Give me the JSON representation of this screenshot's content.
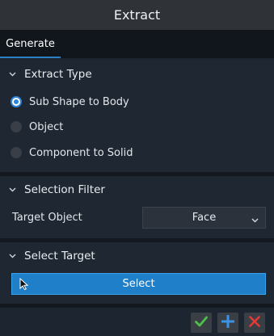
{
  "title": "Extract",
  "tabs": [
    {
      "label": "Generate",
      "active": true
    }
  ],
  "extract_type": {
    "header": "Extract Type",
    "options": [
      {
        "label": "Sub Shape to Body",
        "selected": true
      },
      {
        "label": "Object",
        "selected": false
      },
      {
        "label": "Component to Solid",
        "selected": false
      }
    ]
  },
  "selection_filter": {
    "header": "Selection Filter",
    "target_object_label": "Target Object",
    "target_object_value": "Face"
  },
  "select_target": {
    "header": "Select Target",
    "button_label": "Select"
  },
  "footer": {
    "ok_icon": "check-icon",
    "add_icon": "plus-icon",
    "cancel_icon": "close-icon"
  },
  "colors": {
    "accent": "#1f7fc9",
    "ok": "#4cc24a",
    "add": "#3a93e6",
    "cancel": "#e53935"
  }
}
